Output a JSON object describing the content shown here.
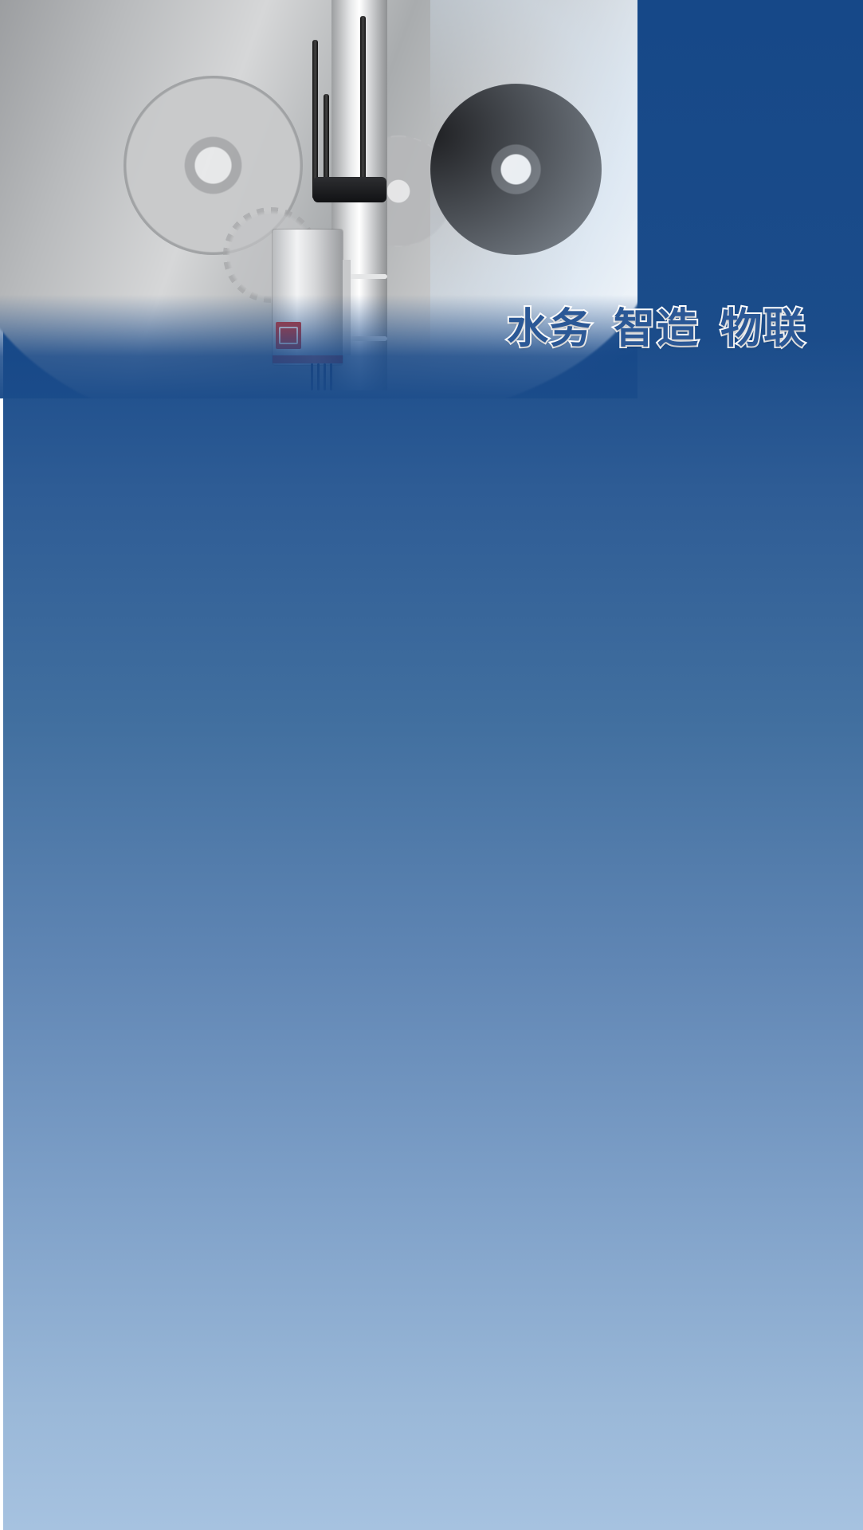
{
  "hero": {
    "slogan": [
      "水务",
      "智造",
      "物联"
    ]
  },
  "colors": {
    "top_blue": "#164888",
    "mid_blue": "#416f9f",
    "bottom_blue": "#a6c2e0",
    "slogan_fill": "#2b5896",
    "slogan_outline": "#ffffff",
    "device_accent": "#d8302c"
  }
}
